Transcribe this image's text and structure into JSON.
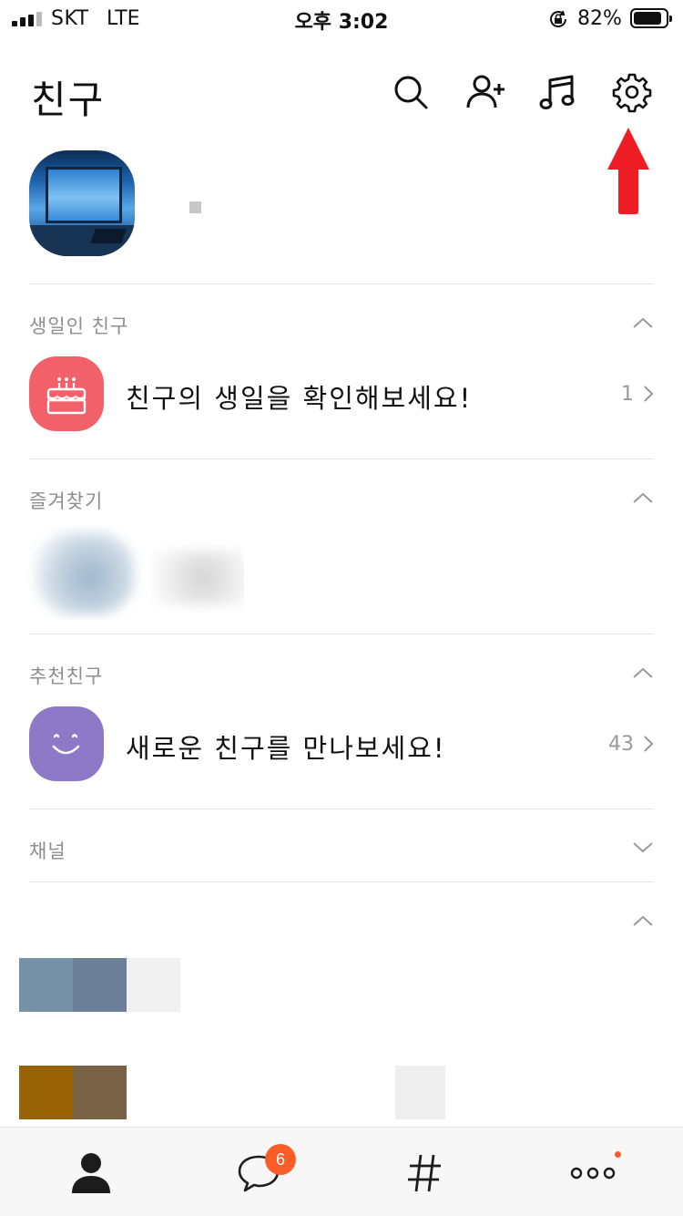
{
  "status_bar": {
    "carrier": "SKT",
    "network": "LTE",
    "time": "오후 3:02",
    "battery_percent": "82%",
    "battery_level": 0.82,
    "signal_bars": 3
  },
  "header": {
    "title": "친구",
    "icons": [
      "search-icon",
      "add-friend-icon",
      "music-icon",
      "settings-icon"
    ]
  },
  "annotation": {
    "arrow_color": "#ee1c25",
    "points_to": "settings-icon"
  },
  "sections": {
    "birthday": {
      "title": "생일인 친구",
      "item_text": "친구의 생일을 확인해보세요!",
      "count": "1",
      "icon_color": "#f2606a"
    },
    "favorites": {
      "title": "즐겨찾기"
    },
    "recommended": {
      "title": "추천친구",
      "item_text": "새로운 친구를 만나보세요!",
      "count": "43",
      "icon_color": "#8e78c8"
    },
    "channel": {
      "title": "채널"
    }
  },
  "tabbar": {
    "tabs": [
      "friends-tab",
      "chats-tab",
      "hashtag-tab",
      "more-tab"
    ],
    "chat_badge": "6",
    "accent": "#fa5d28"
  }
}
